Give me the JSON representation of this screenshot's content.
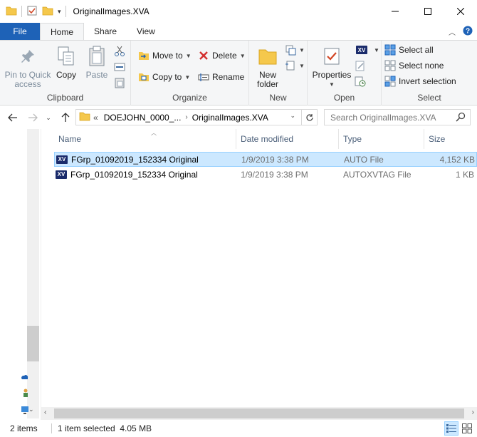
{
  "window": {
    "title": "OriginalImages.XVA"
  },
  "tabs": [
    {
      "label": "File"
    },
    {
      "label": "Home"
    },
    {
      "label": "Share"
    },
    {
      "label": "View"
    }
  ],
  "ribbon": {
    "clipboard": {
      "label": "Clipboard",
      "pin_label_1": "Pin to Quick",
      "pin_label_2": "access",
      "copy_label": "Copy",
      "paste_label": "Paste"
    },
    "organize": {
      "label": "Organize",
      "move_to": "Move to",
      "copy_to": "Copy to",
      "delete": "Delete",
      "rename": "Rename"
    },
    "new": {
      "label": "New",
      "new_folder_1": "New",
      "new_folder_2": "folder"
    },
    "open": {
      "label": "Open",
      "properties": "Properties"
    },
    "select": {
      "label": "Select",
      "select_all": "Select all",
      "select_none": "Select none",
      "invert": "Invert selection"
    }
  },
  "address": {
    "prefix": "«",
    "crumbs": [
      "DOEJOHN_0000_...",
      "OriginalImages.XVA"
    ]
  },
  "search": {
    "placeholder": "Search OriginalImages.XVA"
  },
  "columns": [
    {
      "label": "Name"
    },
    {
      "label": "Date modified"
    },
    {
      "label": "Type"
    },
    {
      "label": "Size"
    }
  ],
  "files": [
    {
      "icon_text": "XV",
      "name": "FGrp_01092019_152334 Original",
      "date": "1/9/2019 3:38 PM",
      "type": "AUTO File",
      "size": "4,152 KB",
      "selected": true
    },
    {
      "icon_text": "XV",
      "name": "FGrp_01092019_152334 Original",
      "date": "1/9/2019 3:38 PM",
      "type": "AUTOXVTAG File",
      "size": "1 KB",
      "selected": false
    }
  ],
  "status": {
    "items": "2 items",
    "selection": "1 item selected  4.05 MB"
  },
  "colors": {
    "file_tab": "#1e62b7",
    "selection": "#cce8ff",
    "selection_border": "#99d1ff",
    "xv_badge": "#1a2b6b"
  }
}
